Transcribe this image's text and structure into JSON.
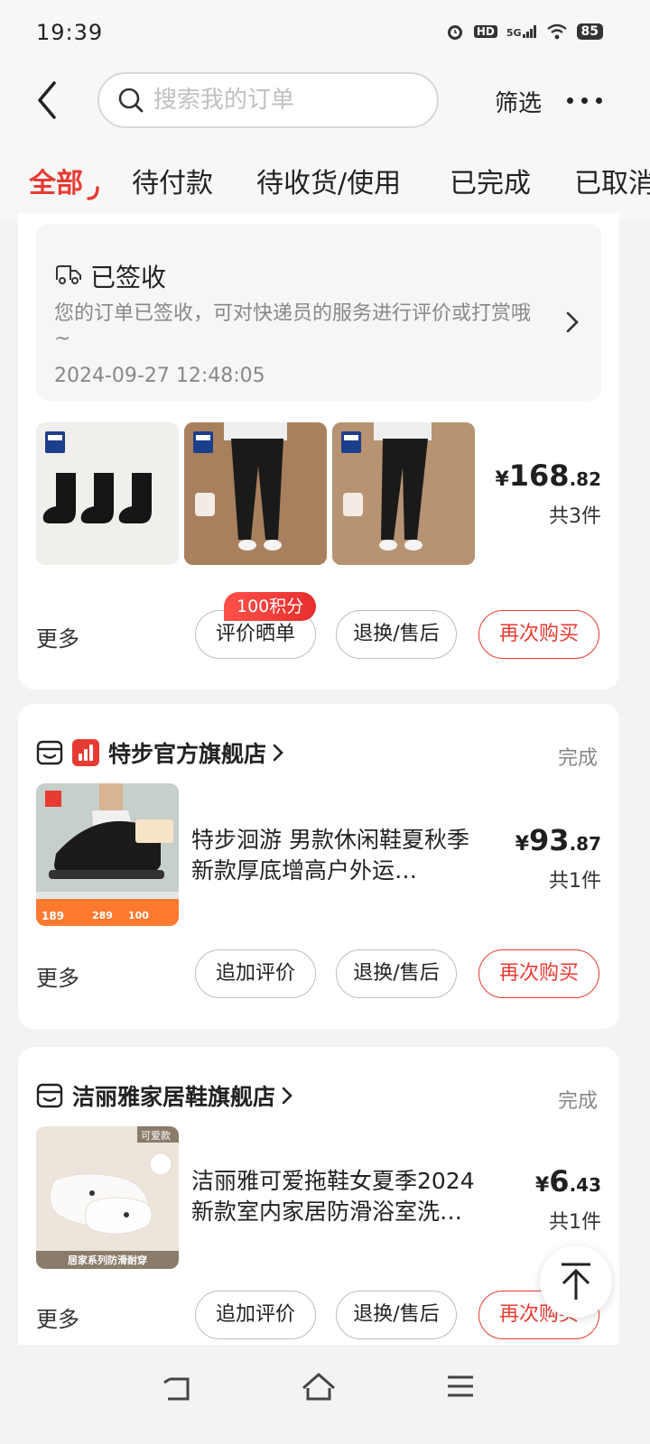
{
  "status_bar": {
    "time": "19:39",
    "network": "5G",
    "hd": "HD",
    "battery": "85"
  },
  "header": {
    "search_placeholder": "搜索我的订单",
    "filter_label": "筛选"
  },
  "tabs": [
    {
      "label": "全部",
      "active": true
    },
    {
      "label": "待付款",
      "active": false
    },
    {
      "label": "待收货/使用",
      "active": false
    },
    {
      "label": "已完成",
      "active": false
    },
    {
      "label": "已取消",
      "active": false
    }
  ],
  "orders": [
    {
      "delivery": {
        "status": "已签收",
        "description": "您的订单已签收，可对快递员的服务进行评价或打赏哦~",
        "time": "2024-09-27 12:48:05"
      },
      "thumbs": [
        "socks",
        "pants",
        "pants"
      ],
      "price": {
        "symbol": "¥",
        "integer": "168",
        "decimal": ".82"
      },
      "count": "共3件",
      "more": "更多",
      "points_badge": "100积分",
      "buttons": [
        "评价晒单",
        "退换/售后",
        "再次购买"
      ]
    },
    {
      "shop": "特步官方旗舰店",
      "status": "完成",
      "title": "特步洄游  男款休闲鞋夏秋季新款厚底增高户外运…",
      "thumb_prices": [
        "189",
        "289",
        "100"
      ],
      "price": {
        "symbol": "¥",
        "integer": "93",
        "decimal": ".87"
      },
      "count": "共1件",
      "more": "更多",
      "buttons": [
        "追加评价",
        "退换/售后",
        "再次购买"
      ]
    },
    {
      "shop": "洁丽雅家居鞋旗舰店",
      "status": "完成",
      "title": "洁丽雅可爱拖鞋女夏季2024新款室内家居防滑浴室洗…",
      "thumb_tag": "可爱款",
      "thumb_caption": "居家系列防滑耐穿",
      "price": {
        "symbol": "¥",
        "integer": "6",
        "decimal": ".43"
      },
      "count": "共1件",
      "more": "更多",
      "buttons": [
        "追加评价",
        "退换/售后",
        "再次购买"
      ]
    }
  ],
  "colors": {
    "accent": "#e63b33",
    "background": "#f3f3f3",
    "card": "#ffffff",
    "muted": "#888888"
  }
}
